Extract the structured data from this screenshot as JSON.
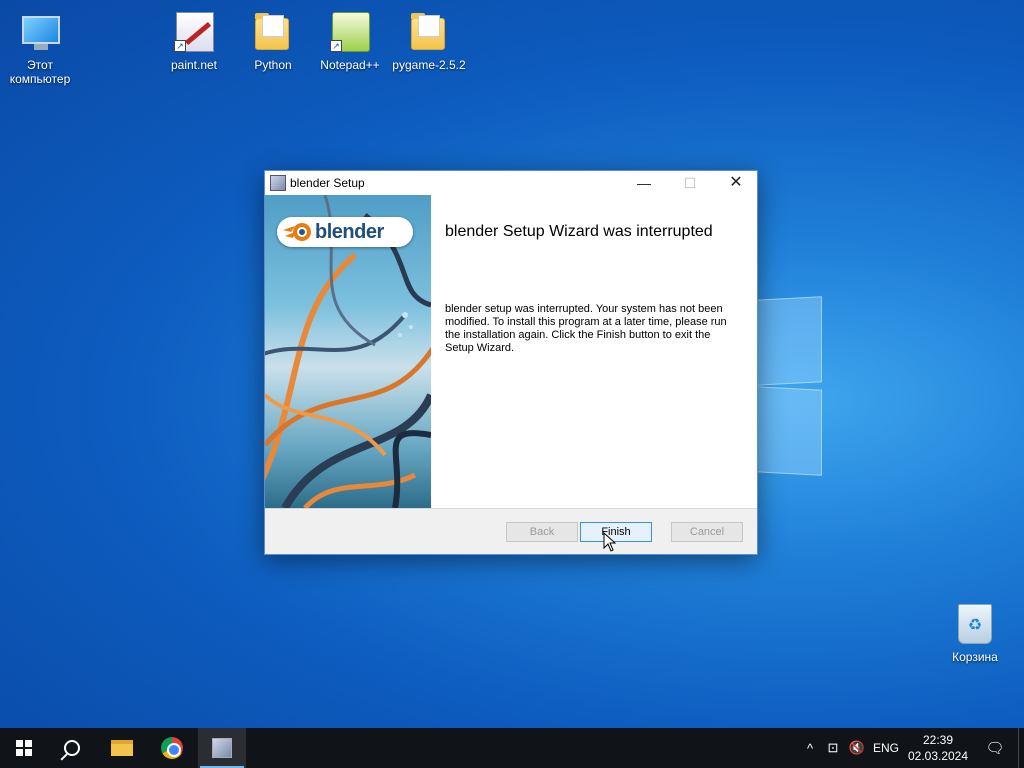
{
  "desktop": {
    "icons": [
      {
        "label": "Этот компьютер",
        "icon": "this-pc-icon"
      },
      {
        "label": "paint.net",
        "icon": "paintnet-icon"
      },
      {
        "label": "Python",
        "icon": "folder-icon"
      },
      {
        "label": "Notepad++",
        "icon": "notepadpp-icon"
      },
      {
        "label": "pygame-2.5.2",
        "icon": "folder-icon"
      }
    ],
    "recycle_bin": {
      "label": "Корзина",
      "icon": "recycle-bin-icon"
    }
  },
  "dialog": {
    "title": "blender Setup",
    "logo_text": "blender",
    "heading": "blender Setup Wizard was interrupted",
    "body": "blender setup was interrupted. Your system has not been modified. To install this program at a later time, please run the installation again. Click the Finish button to exit the Setup Wizard.",
    "buttons": {
      "back": "Back",
      "finish": "Finish",
      "cancel": "Cancel"
    },
    "titlebar_glyphs": {
      "minimize": "—",
      "maximize": "☐",
      "close": "✕"
    }
  },
  "taskbar": {
    "items": [
      "start-icon",
      "search-icon",
      "file-explorer-icon",
      "chrome-icon",
      "setup-icon"
    ],
    "tray": {
      "up_arrow": "^",
      "network": "⊡",
      "volume": "🔇",
      "language": "ENG",
      "time": "22:39",
      "date": "02.03.2024",
      "notification_glyph": "🗨"
    }
  },
  "colors": {
    "accent": "#1b86e0",
    "taskbar": "#101418",
    "focus_border": "#3c8ee0"
  }
}
